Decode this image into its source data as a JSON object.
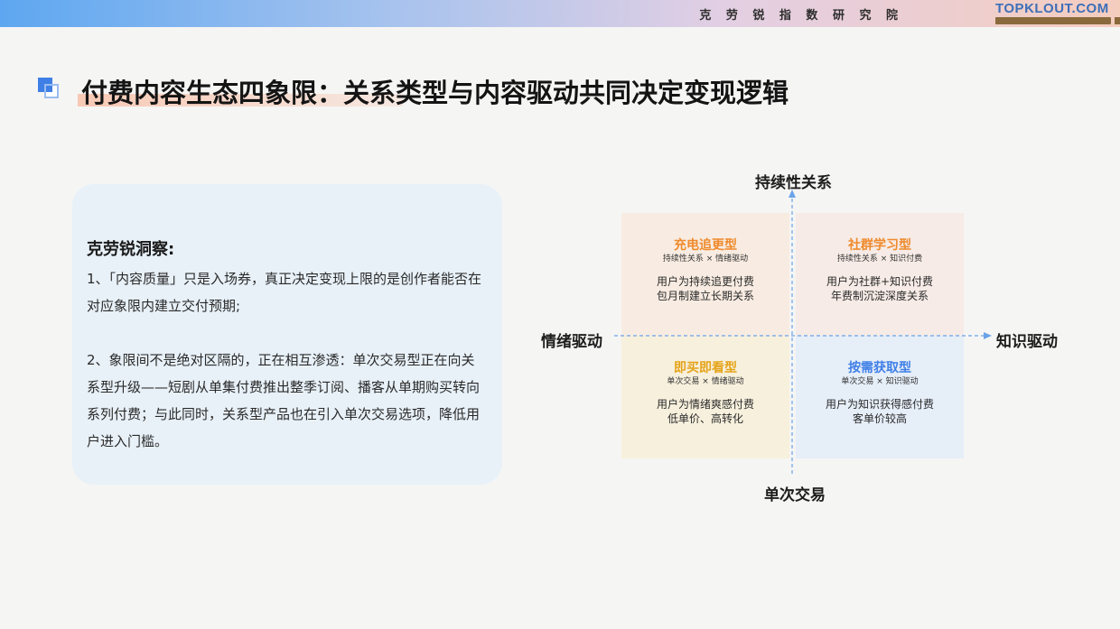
{
  "header": {
    "institute": "克 劳 锐 指 数 研 究 院",
    "brand": "TOPKLOUT.COM"
  },
  "title": "付费内容生态四象限：关系类型与内容驱动共同决定变现逻辑",
  "insight": {
    "heading": "克劳锐洞察:",
    "point1": "1、「内容质量」只是入场券，真正决定变现上限的是创作者能否在对应象限内建立交付预期;",
    "point2": "2、象限间不是绝对区隔的，正在相互渗透：单次交易型正在向关系型升级——短剧从单集付费推出整季订阅、播客从单期购买转向系列付费；与此同时，关系型产品也在引入单次交易选项，降低用户进入门槛。"
  },
  "axes": {
    "top": "持续性关系",
    "bottom": "单次交易",
    "left": "情绪驱动",
    "right": "知识驱动"
  },
  "quadrants": [
    {
      "title": "充电追更型",
      "sub": "持续性关系 × 情绪驱动",
      "desc1": "用户为持续追更付费",
      "desc2": "包月制建立长期关系",
      "color": "#ef8a2c"
    },
    {
      "title": "社群学习型",
      "sub": "持续性关系 × 知识付费",
      "desc1": "用户为社群+知识付费",
      "desc2": "年费制沉淀深度关系",
      "color": "#ef8a2c"
    },
    {
      "title": "即买即看型",
      "sub": "单次交易 × 情绪驱动",
      "desc1": "用户为情绪爽感付费",
      "desc2": "低单价、高转化",
      "color": "#e5a319"
    },
    {
      "title": "按需获取型",
      "sub": "单次交易 × 知识驱动",
      "desc1": "用户为知识获得感付费",
      "desc2": "客单价较高",
      "color": "#3f7fe6"
    }
  ],
  "colors": {
    "accent_blue": "#3f7fe6",
    "insight_bg": "#e8f1f8",
    "axis_line": "#6aa3e8"
  }
}
